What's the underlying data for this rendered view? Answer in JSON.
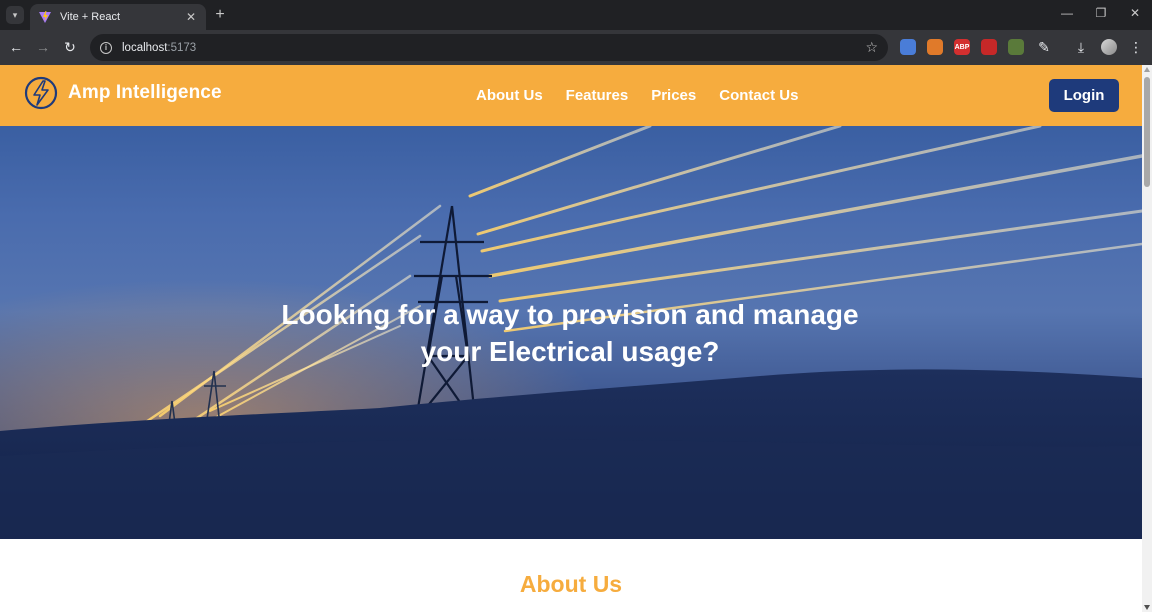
{
  "browser": {
    "tab_title": "Vite + React",
    "url_host": "localhost",
    "url_port": ":5173",
    "extensions": [
      {
        "name": "translate-extension-icon",
        "label": "",
        "color": "#4a7dd8"
      },
      {
        "name": "fox-extension-icon",
        "label": "",
        "color": "#e07a2a"
      },
      {
        "name": "adblock-extension-icon",
        "label": "ABP",
        "color": "#d32f2f"
      },
      {
        "name": "block-extension-icon",
        "label": "",
        "color": "#c62828"
      },
      {
        "name": "circle-extension-icon",
        "label": "",
        "color": "#5a7a3a"
      }
    ]
  },
  "header": {
    "brand_name": "Amp Intelligence",
    "nav": [
      "About Us",
      "Features",
      "Prices",
      "Contact Us"
    ],
    "login_label": "Login",
    "accent_color": "#f6ac3e",
    "button_color": "#1e3a7b"
  },
  "hero": {
    "title": "Looking for a way to provision and manage your Electrical usage?"
  },
  "about": {
    "title": "About Us"
  }
}
